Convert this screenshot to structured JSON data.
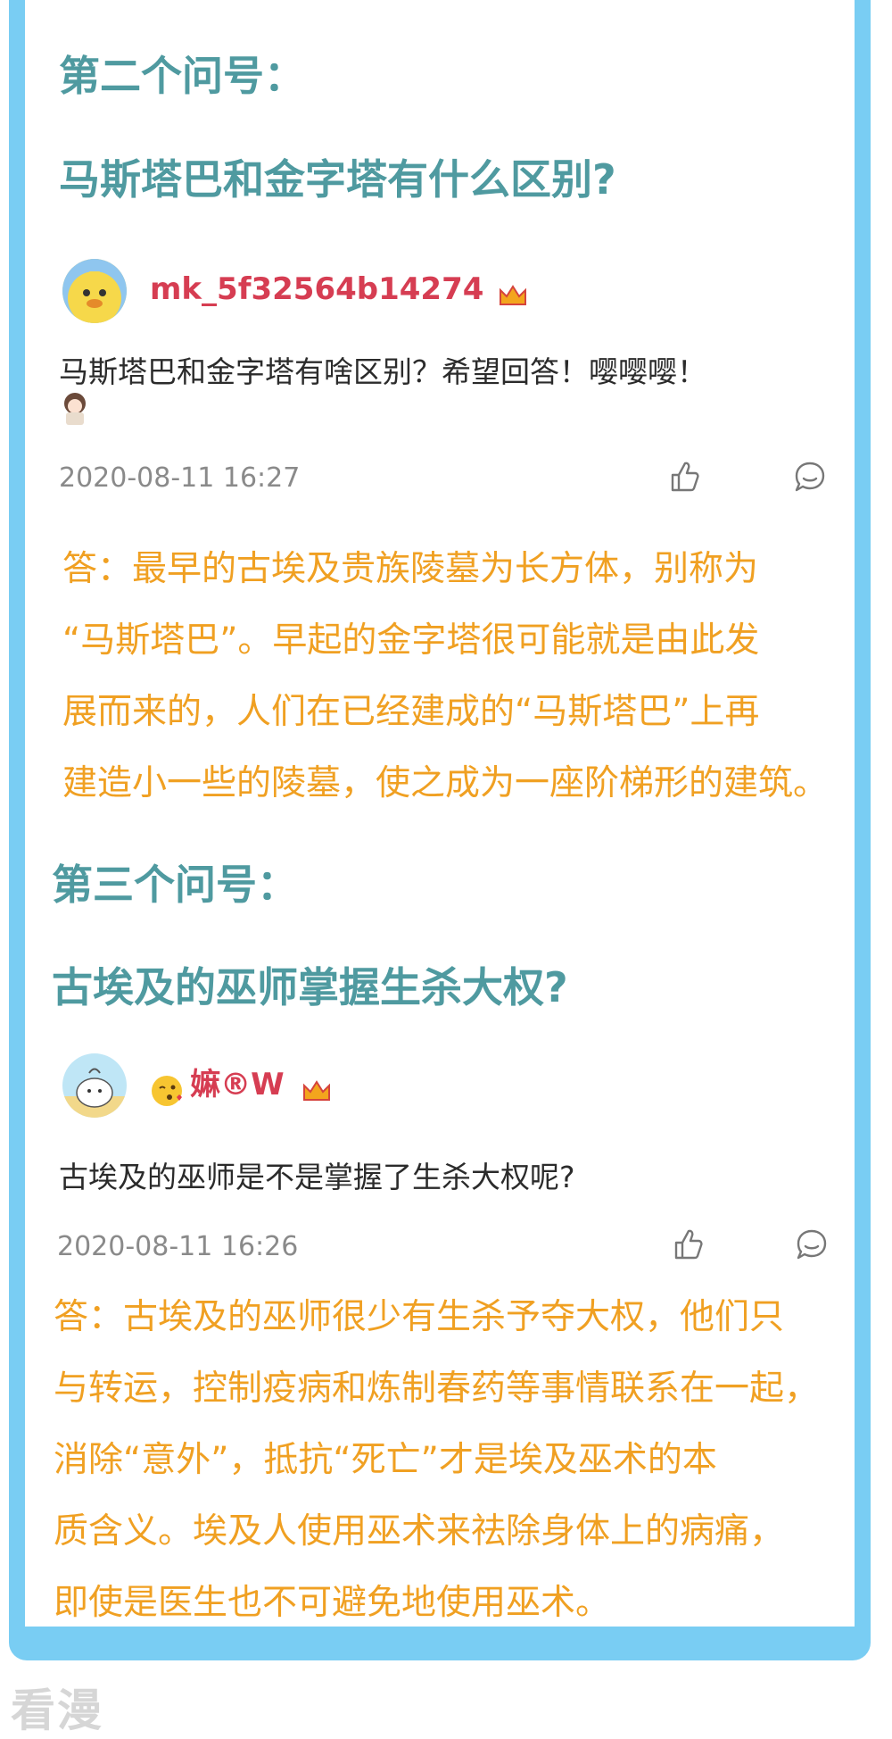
{
  "section2": {
    "heading": "第二个问号：",
    "question": "马斯塔巴和金字塔有什么区别?",
    "user": {
      "name": "mk_5f32564b14274",
      "avatar": "chick-avatar-icon"
    },
    "comment": "马斯塔巴和金字塔有啥区别？希望回答！嘤嘤嘤！",
    "timestamp": "2020-08-11 16:27",
    "answer_lines": [
      "答：最早的古埃及贵族陵墓为长方体，别称为",
      "“马斯塔巴”。早起的金字塔很可能就是由此发",
      "展而来的，人们在已经建成的“马斯塔巴”上再",
      "建造小一些的陵墓，使之成为一座阶梯形的建筑。"
    ]
  },
  "section3": {
    "heading": "第三个问号：",
    "question": "古埃及的巫师掌握生杀大权?",
    "user": {
      "name": "嫲®W",
      "avatar": "bun-avatar-icon",
      "emoji": "kissing-face-icon"
    },
    "comment": "古埃及的巫师是不是掌握了生杀大权呢?",
    "timestamp": "2020-08-11 16:26",
    "answer_lines": [
      "答：古埃及的巫师很少有生杀予夺大权，他们只",
      "与转运，控制疫病和炼制春药等事情联系在一起，",
      "消除“意外”，抵抗“死亡”才是埃及巫术的本",
      "质含义。埃及人使用巫术来祛除身体上的病痛，",
      "即使是医生也不可避免地使用巫术。"
    ]
  },
  "watermark": "看漫",
  "colors": {
    "frame": "#79cdf3",
    "heading": "#4f9aa0",
    "username": "#d63d52",
    "answer": "#f0a022",
    "timestamp": "#8a8a8a"
  }
}
